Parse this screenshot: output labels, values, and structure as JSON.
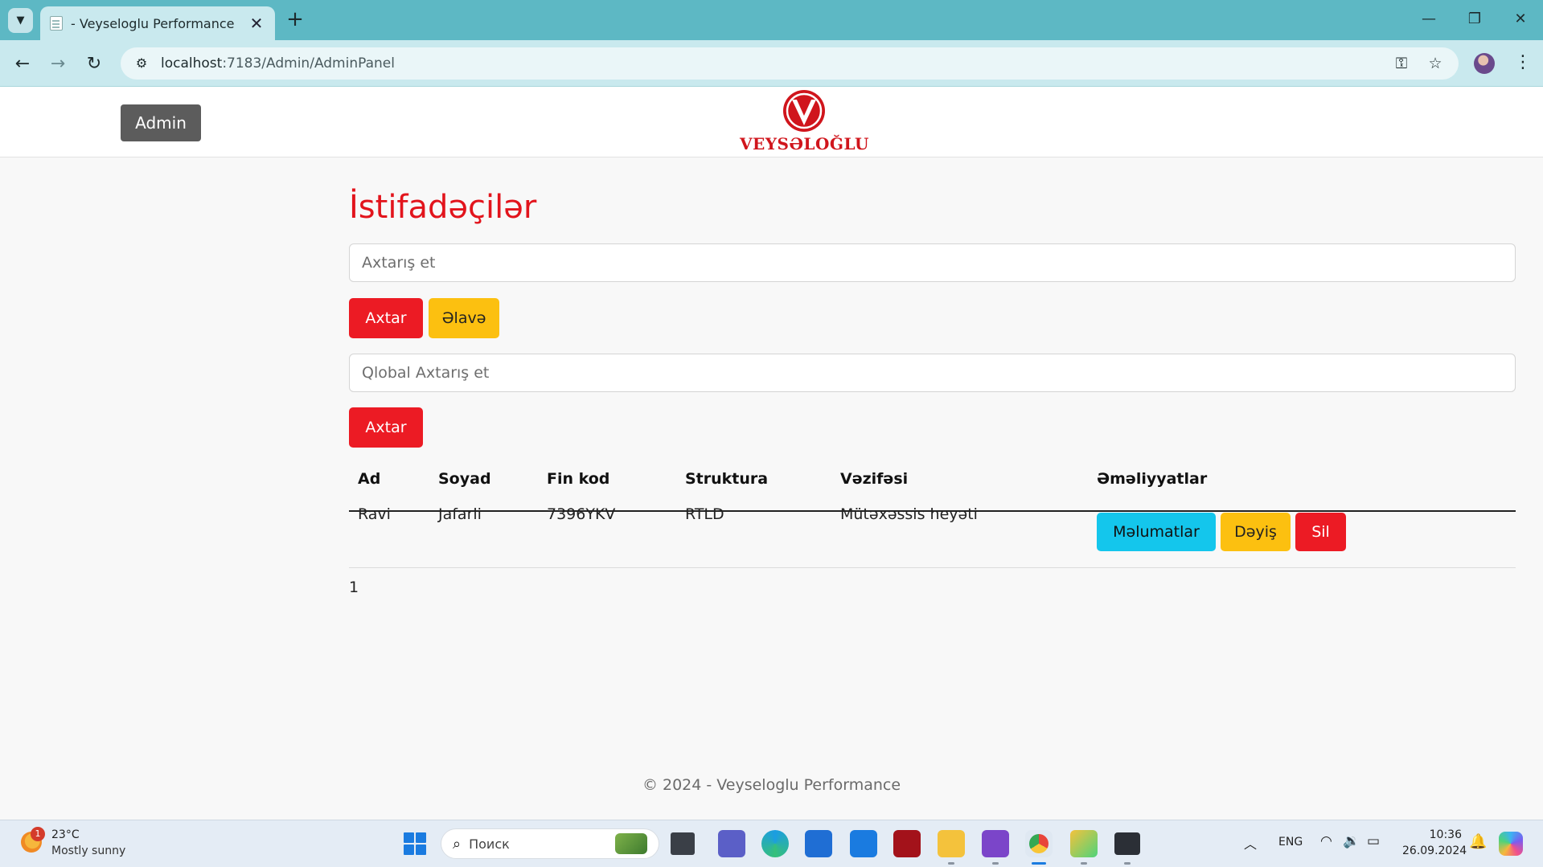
{
  "browser": {
    "tab_title": "- Veyseloglu Performance",
    "tab_close": "✕",
    "new_tab": "+",
    "url_host": "localhost",
    "url_path": ":7183/Admin/AdminPanel",
    "window_controls": {
      "minimize": "—",
      "restore": "❐",
      "close": "✕"
    }
  },
  "header": {
    "admin_button": "Admin",
    "logo_text": "VEYSƏLOĞLU"
  },
  "main": {
    "title": "İstifadəçilər",
    "search_placeholder": "Axtarış et",
    "search_button": "Axtar",
    "add_button": "Əlavə",
    "global_search_placeholder": "Qlobal Axtarış et",
    "global_search_button": "Axtar"
  },
  "table": {
    "headers": [
      "Ad",
      "Soyad",
      "Fin kod",
      "Struktura",
      "Vəzifəsi",
      "Əməliyyatlar"
    ],
    "rows": [
      {
        "ad": "Ravi",
        "soyad": "Jafarli",
        "fin_kod": "7396YKV",
        "struktura": "RTLD",
        "vezifesi": "Mütəxəssis heyəti",
        "actions": {
          "details": "Məlumatlar",
          "edit": "Dəyiş",
          "delete": "Sil"
        }
      }
    ]
  },
  "pagination": {
    "current_page": "1"
  },
  "footer": {
    "text": "© 2024 - Veyseloglu Performance"
  },
  "taskbar": {
    "weather_temp": "23°C",
    "weather_desc": "Mostly sunny",
    "weather_badge": "1",
    "search_placeholder": "Поиск",
    "language": "ENG",
    "time": "10:36",
    "date": "26.09.2024"
  },
  "colors": {
    "brand_red": "#e2141c",
    "button_red": "#ec1b24",
    "button_yellow": "#fcc010",
    "button_cyan": "#14c6ec",
    "admin_gray": "#5c5c5c",
    "titlebar": "#5db8c4"
  }
}
